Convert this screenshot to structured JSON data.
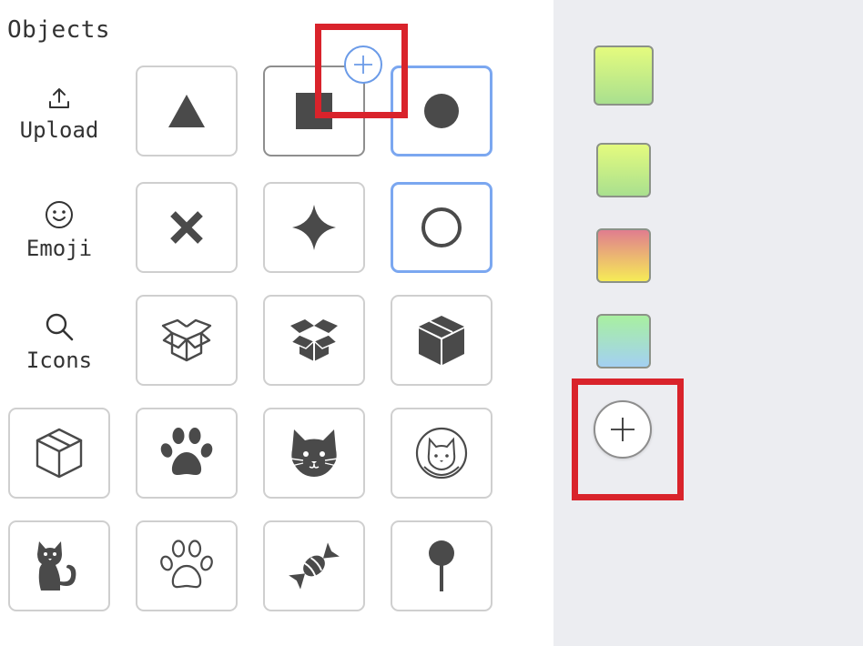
{
  "panel": {
    "title": "Objects"
  },
  "sidebar": {
    "items": [
      {
        "id": "upload",
        "label": "Upload",
        "icon": "upload-icon"
      },
      {
        "id": "emoji",
        "label": "Emoji",
        "icon": "smiley-icon"
      },
      {
        "id": "icons",
        "label": "Icons",
        "icon": "search-icon"
      }
    ]
  },
  "shapes": [
    "triangle-icon",
    "square-icon",
    "filled-circle-icon",
    "x-icon",
    "four-point-star-icon",
    "outline-circle-icon",
    "open-box-outline-icon",
    "open-box-filled-icon",
    "box-3d-filled-icon",
    "box-outline-icon",
    "paw-filled-icon",
    "cat-face-icon",
    "cat-badge-icon",
    "sitting-cat-icon",
    "paw-outline-icon",
    "candy-icon",
    "lollipop-icon"
  ],
  "add_badge": {
    "icon": "plus-icon",
    "color": "#6b9be8"
  },
  "swatches": [
    {
      "name": "lime-green-gradient",
      "from": "#e4fb7e",
      "to": "#a9e08f"
    },
    {
      "name": "lime-green-gradient-2",
      "from": "#e4fb7e",
      "to": "#a9e08f"
    },
    {
      "name": "pink-yellow-gradient",
      "from": "#e07d8f",
      "to": "#f6ec57"
    },
    {
      "name": "green-blue-gradient",
      "from": "#a8f0a0",
      "to": "#a3d0f2"
    }
  ],
  "add_swatch": {
    "icon": "plus-icon"
  },
  "colors": {
    "highlight": "#d9232b",
    "selected_border": "#7ba7f0",
    "icon_fill": "#4a4a4a",
    "right_panel_bg": "#ecedf1"
  }
}
